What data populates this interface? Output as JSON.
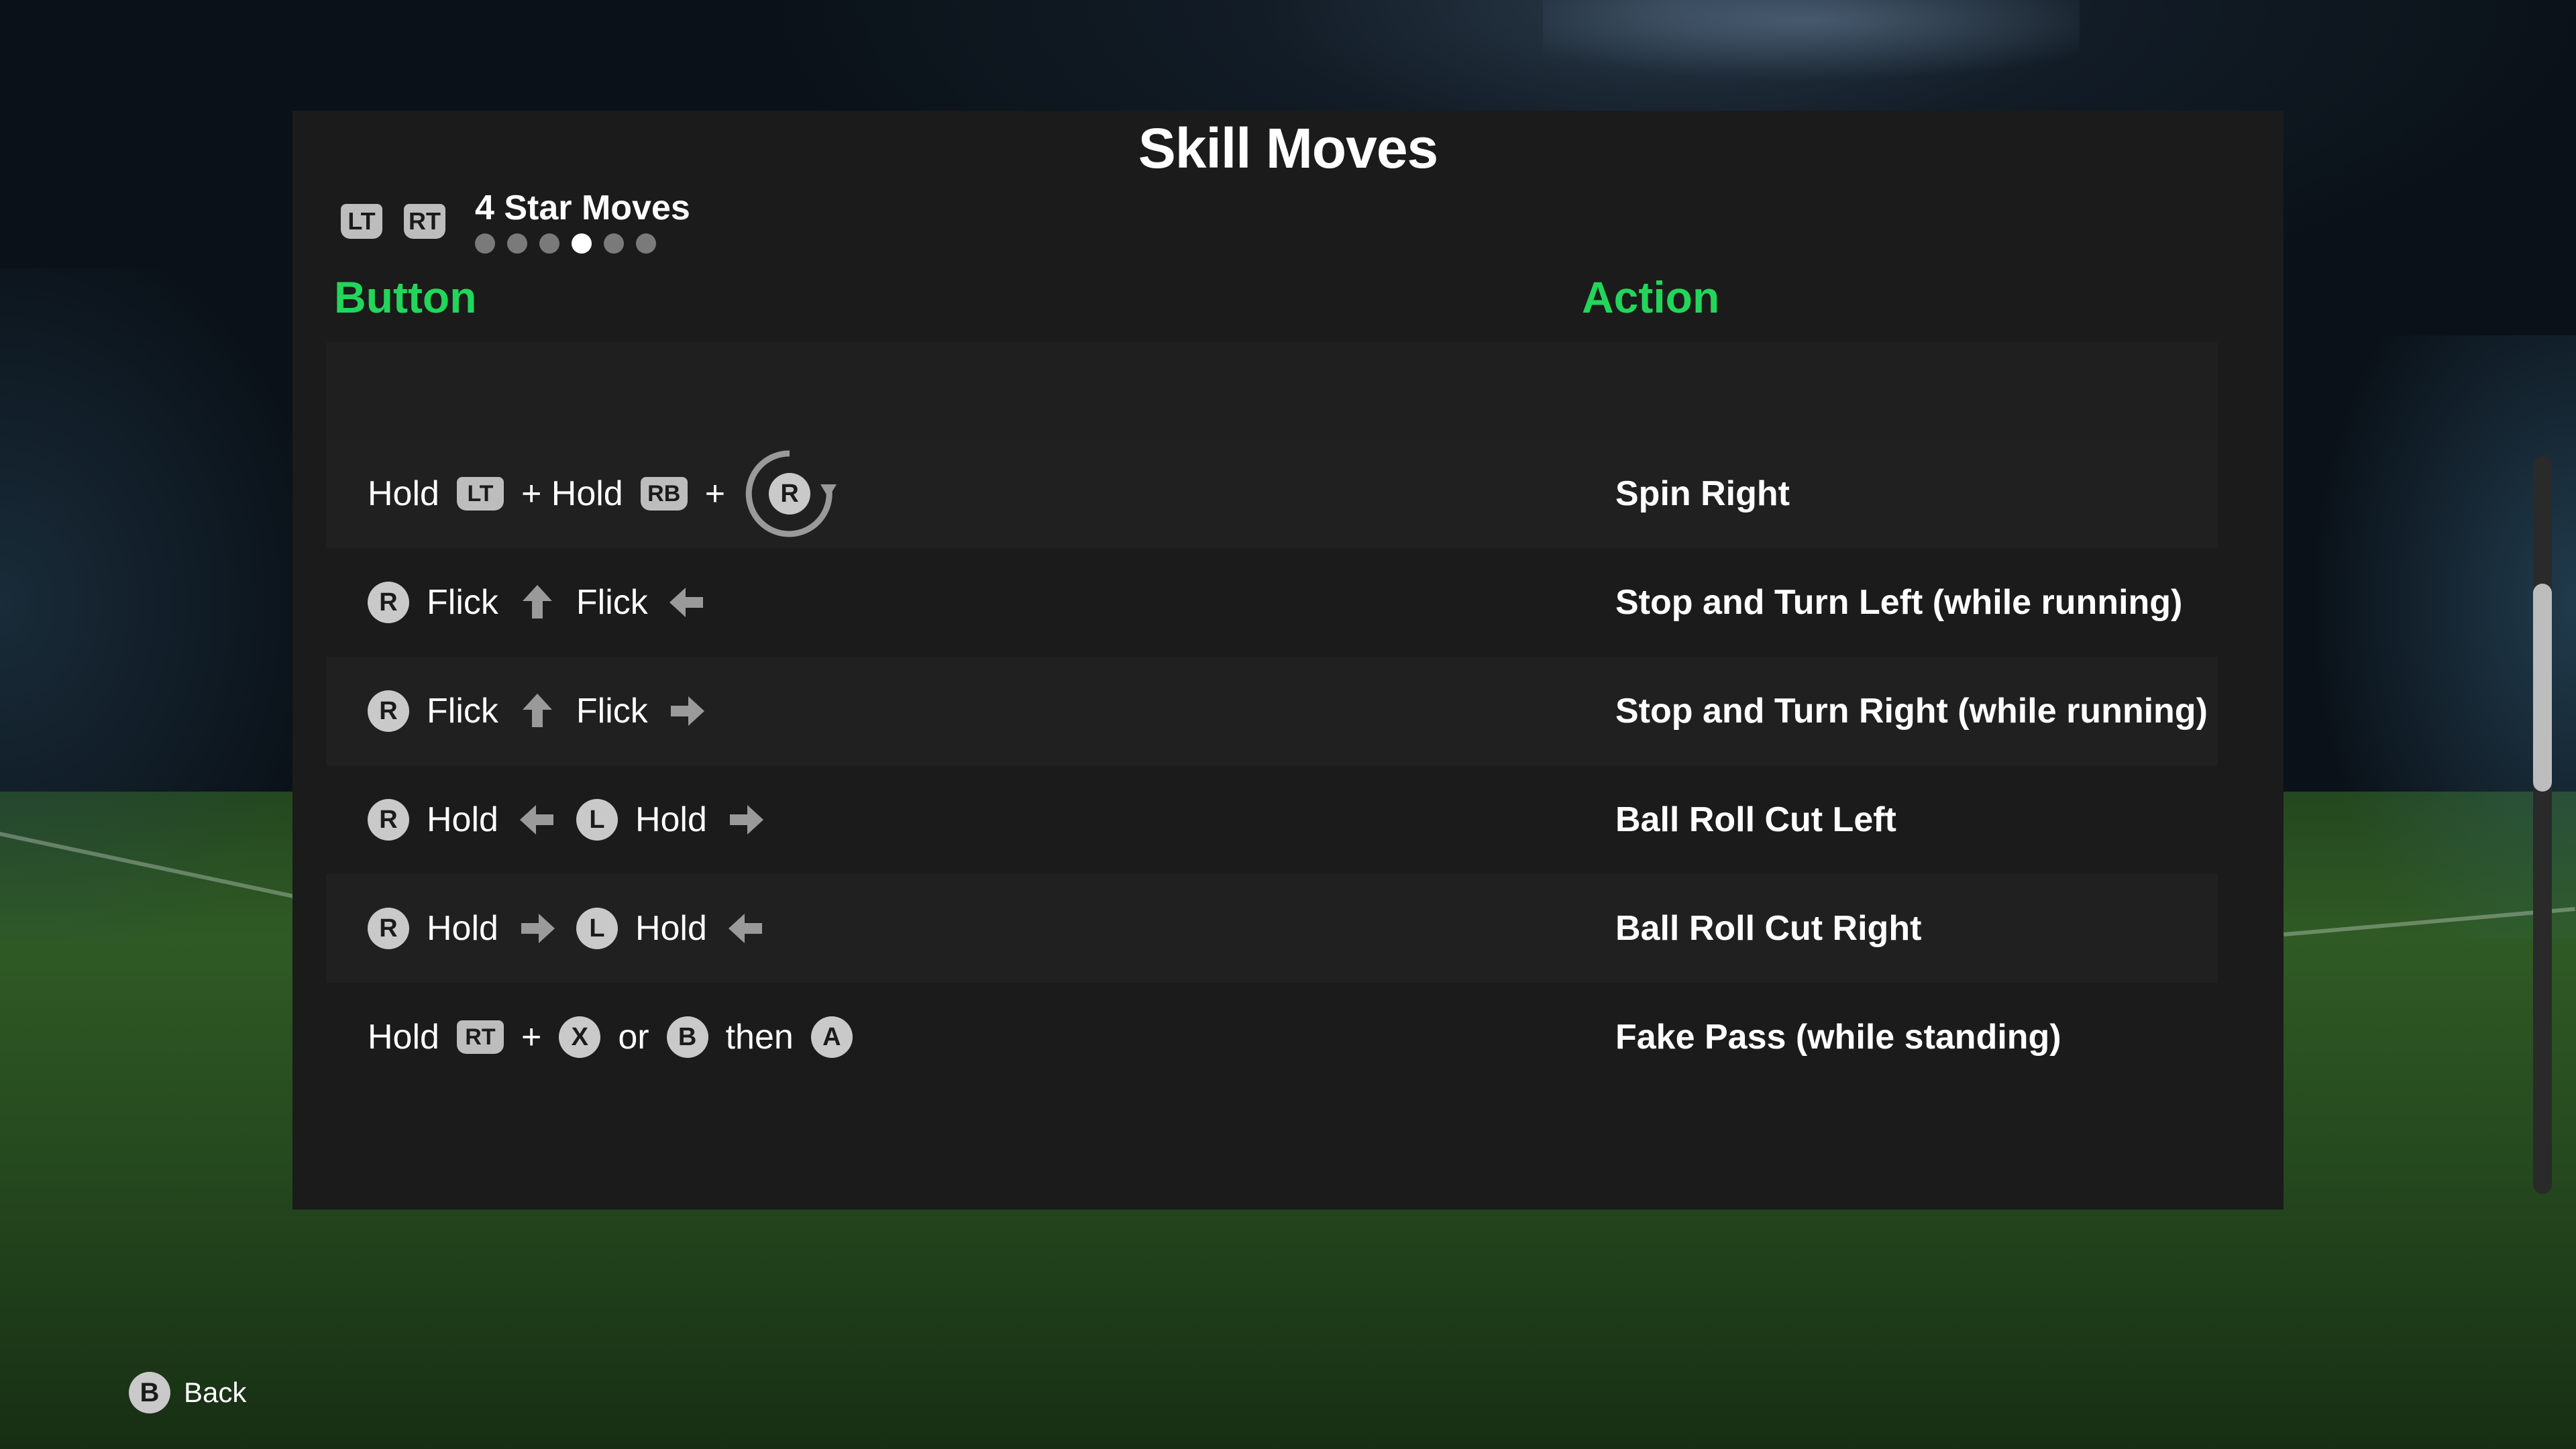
{
  "title": "Skill Moves",
  "category": {
    "shoulder_left": "LT",
    "shoulder_right": "RT",
    "label": "4 Star Moves",
    "page_count": 6,
    "active_page": 4
  },
  "columns": {
    "button": "Button",
    "action": "Action"
  },
  "rows": [
    {
      "action": "Spin Right",
      "seq": [
        {
          "t": "text",
          "v": "Hold"
        },
        {
          "t": "tag",
          "v": "LT"
        },
        {
          "t": "text",
          "v": "+ Hold"
        },
        {
          "t": "tag",
          "v": "RB"
        },
        {
          "t": "text",
          "v": "+"
        },
        {
          "t": "rot",
          "v": "R"
        }
      ]
    },
    {
      "action": "Stop and Turn Left (while running)",
      "seq": [
        {
          "t": "circ",
          "v": "R"
        },
        {
          "t": "text",
          "v": "Flick"
        },
        {
          "t": "arrow",
          "v": "up"
        },
        {
          "t": "text",
          "v": "Flick"
        },
        {
          "t": "arrow",
          "v": "left"
        }
      ]
    },
    {
      "action": "Stop and Turn Right (while running)",
      "seq": [
        {
          "t": "circ",
          "v": "R"
        },
        {
          "t": "text",
          "v": "Flick"
        },
        {
          "t": "arrow",
          "v": "up"
        },
        {
          "t": "text",
          "v": "Flick"
        },
        {
          "t": "arrow",
          "v": "right"
        }
      ]
    },
    {
      "action": "Ball Roll Cut Left",
      "seq": [
        {
          "t": "circ",
          "v": "R"
        },
        {
          "t": "text",
          "v": "Hold"
        },
        {
          "t": "arrow",
          "v": "left"
        },
        {
          "t": "circ",
          "v": "L"
        },
        {
          "t": "text",
          "v": "Hold"
        },
        {
          "t": "arrow",
          "v": "right"
        }
      ]
    },
    {
      "action": "Ball Roll Cut Right",
      "seq": [
        {
          "t": "circ",
          "v": "R"
        },
        {
          "t": "text",
          "v": "Hold"
        },
        {
          "t": "arrow",
          "v": "right"
        },
        {
          "t": "circ",
          "v": "L"
        },
        {
          "t": "text",
          "v": "Hold"
        },
        {
          "t": "arrow",
          "v": "left"
        }
      ]
    },
    {
      "action": "Fake Pass (while standing)",
      "seq": [
        {
          "t": "text",
          "v": "Hold"
        },
        {
          "t": "tag",
          "v": "RT"
        },
        {
          "t": "text",
          "v": "+"
        },
        {
          "t": "circ",
          "v": "X"
        },
        {
          "t": "text",
          "v": "or"
        },
        {
          "t": "circ",
          "v": "B"
        },
        {
          "t": "text",
          "v": "then"
        },
        {
          "t": "circ",
          "v": "A"
        }
      ]
    }
  ],
  "scroll_position": 0.24,
  "footer": {
    "button": "B",
    "label": "Back"
  },
  "colors": {
    "accent": "#22d65a",
    "panel": "#1b1b1b"
  }
}
